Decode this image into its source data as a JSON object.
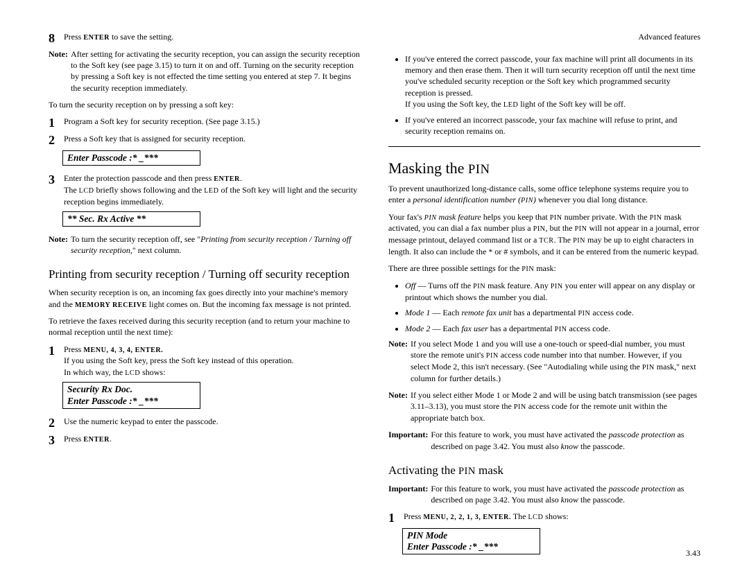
{
  "header": {
    "right": "Advanced features"
  },
  "page_num": "3.43",
  "left": {
    "step8": {
      "num": "8",
      "text_before": "Press ",
      "enter": "ENTER",
      "text_after": " to save the setting."
    },
    "note1": {
      "label": "Note:",
      "body": "After setting for activating the security reception, you can assign the security reception to the Soft key (see page 3.15) to turn it on and off. Turning on the security reception by pressing a Soft key is not effected the time setting you entered at step 7. It begins the security reception immediately."
    },
    "softkey_intro": "To turn the security reception on by pressing a soft key:",
    "sk_step1": {
      "num": "1",
      "body": "Program a Soft key for security reception. (See page 3.15.)"
    },
    "sk_step2": {
      "num": "2",
      "body": "Press a Soft key that is assigned for security reception."
    },
    "lcd1": "Enter Passcode :*  _***",
    "sk_step3": {
      "num": "3",
      "body_a": "Enter the protection passcode and then press ",
      "enter": "ENTER",
      "period": ".",
      "body_b_a": "The ",
      "lcd_word": "LCD",
      "body_b_b": " briefly shows following and the ",
      "led_word": "LED",
      "body_b_c": " of the Soft key will light and the security reception begins immediately."
    },
    "lcd2": "** Sec. Rx Active **",
    "note2": {
      "label": "Note:",
      "body_a": "To turn the security reception off, see \"",
      "ital": "Printing from security reception / Turning off security reception",
      "body_b": ",\" next column."
    },
    "print_heading": "Printing from security reception / Turning off security reception",
    "print_para1_a": "When security reception is on, an incoming fax goes directly into your machine's memory and the ",
    "mem_receive": "MEMORY RECEIVE",
    "print_para1_b": " light comes on. But the incoming fax message is not printed.",
    "print_para2": "To retrieve the faxes received during this security reception (and to return your machine to normal reception until the next time):",
    "pr_step1": {
      "num": "1",
      "a": "Press ",
      "menu": "MENU, 4, 3, 4, ENTER.",
      "b": "If you using the Soft key, press the Soft key instead of this operation.",
      "c_a": "In which way, the ",
      "lcd": "LCD",
      "c_b": " shows:"
    },
    "lcd3_line1": "Security Rx Doc.",
    "lcd3_line2": "Enter Passcode :*  _***",
    "pr_step2": {
      "num": "2",
      "body": "Use the numeric keypad to enter the passcode."
    },
    "pr_step3": {
      "num": "3",
      "a": "Press ",
      "enter": "ENTER",
      "b": "."
    }
  },
  "right": {
    "bullet1_a": "If you've entered the correct passcode, your fax machine will print all documents in its memory and then erase them. Then it will turn security reception off until the next time you've scheduled security reception or the Soft key which programmed security reception is pressed.",
    "bullet1_b_a": "If you using the Soft key, the ",
    "led": "LED",
    "bullet1_b_b": " light of the Soft key will be off.",
    "bullet2": "If you've entered an incorrect passcode, your fax machine will refuse to print, and security reception remains on.",
    "mask_heading_a": "Masking the ",
    "pin": "PIN",
    "mask_p1_a": "To prevent unauthorized long-distance calls, some office telephone systems require you to enter a ",
    "mask_p1_ital": "personal identification number (",
    "mask_p1_pin_ital": "PIN",
    "mask_p1_close": ")",
    "mask_p1_b": " whenever you dial long distance.",
    "mask_p2_a": "Your fax's ",
    "mask_p2_ital_a": "PIN",
    "mask_p2_ital_b": " mask feature",
    "mask_p2_b": " helps you keep that ",
    "mask_p2_c": " number private. With the ",
    "mask_p2_d": " mask activated, you can dial a fax number plus a ",
    "mask_p2_e": ", but the ",
    "mask_p2_f": " will not appear in a journal, error message printout, delayed command list or a ",
    "tcr": "TCR",
    "mask_p2_g": ". The ",
    "mask_p2_h": " may be up to eight characters in length. It also can include the * or # symbols, and it can be entered from the numeric keypad.",
    "mask_p3_a": "There are three possible settings for the ",
    "mask_p3_b": " mask:",
    "opt_off_label": "Off",
    "opt_off_a": " — Turns off the ",
    "opt_off_b": " mask feature. Any ",
    "opt_off_c": " you enter will appear on any display or printout which shows the number you dial.",
    "opt_m1_label": "Mode 1",
    "opt_m1_a": " — Each ",
    "opt_m1_ital": "remote fax unit",
    "opt_m1_b": " has a departmental ",
    "opt_m1_c": " access code.",
    "opt_m2_label": "Mode 2",
    "opt_m2_a": " — Each ",
    "opt_m2_ital": "fax user",
    "opt_m2_b": " has a departmental ",
    "opt_m2_c": " access code.",
    "note_m1": {
      "label": "Note:",
      "a": "If you select Mode 1 and you will use a one-touch or speed-dial number, you must store the remote unit's ",
      "b": " access code number into that number. However, if you select Mode 2, this isn't necessary. (See \"Autodialing while using the ",
      "c": " mask,\" next column for further details.)"
    },
    "note_m2": {
      "label": "Note:",
      "a": "If you select either Mode 1 or Mode 2 and will be using batch transmission (see pages 3.11–3.13), you must store the ",
      "b": " access code for the remote unit within the appropriate batch box."
    },
    "important1": {
      "label": "Important:",
      "a": "For this feature to work, you must have activated the ",
      "ital": "passcode protection",
      "b": " as described on page 3.42. You must also ",
      "know": "know",
      "c": " the passcode."
    },
    "activate_heading_a": "Activating the ",
    "activate_heading_b": " mask",
    "important2": {
      "label": "Important:",
      "a": "For this feature to work, you must have activated the ",
      "ital": "passcode protection",
      "b": " as described on page 3.42. You must also ",
      "know": "know",
      "c": " the passcode."
    },
    "act_step1": {
      "num": "1",
      "a": "Press ",
      "menu": "MENU, 2, 2, 1, 3, ENTER.",
      "b": " The ",
      "lcd": "LCD",
      "c": " shows:"
    },
    "lcd4_line1": "PIN  Mode",
    "lcd4_line2": "Enter Passcode :*  _***"
  }
}
